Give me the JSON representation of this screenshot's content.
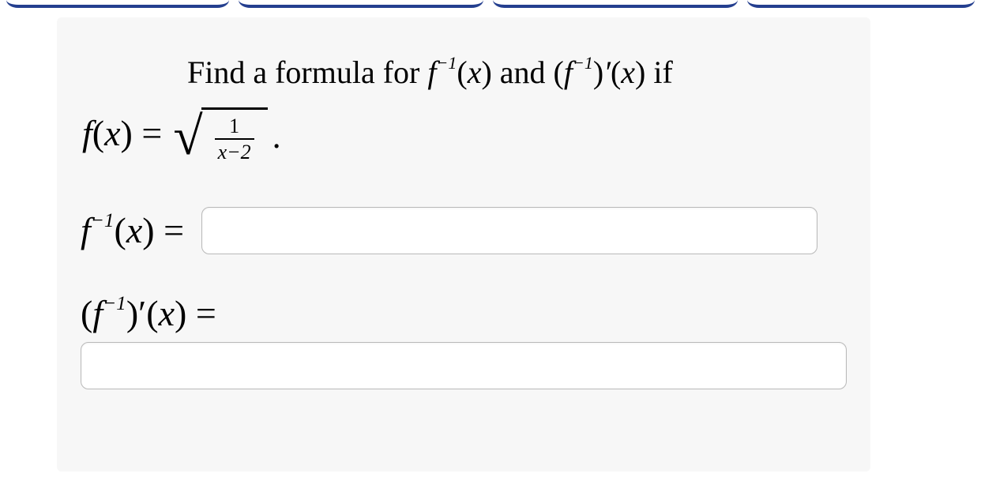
{
  "prompt": {
    "lead": "Find a formula for ",
    "middle": " and ",
    "tail": " if"
  },
  "symbols": {
    "f": "f",
    "x": "x",
    "neg1": "−1",
    "prime": "′",
    "equals": "="
  },
  "given": {
    "numerator": "1",
    "denominator": "x−2",
    "period": "."
  },
  "answers": {
    "finv_equals": "=",
    "finvprime_equals": "=",
    "value1": "",
    "value2": ""
  }
}
